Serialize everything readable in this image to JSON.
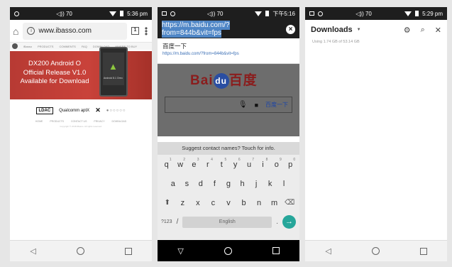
{
  "phone1": {
    "status": {
      "volume": "◁)) 70",
      "time": "5:36 pm"
    },
    "url": "www.ibasso.com",
    "tabs_count": "1",
    "site_nav": [
      "PRODUCTS",
      "COMMENTS",
      "FAQ",
      "DOWNLOAD",
      "WHERE TO BUY"
    ],
    "site_logo_text": "iBasso",
    "banner_lines": [
      "DX200 Android O",
      "Official Release V1.0",
      "Available for Download"
    ],
    "device_text": "Android 8.1 Oreo",
    "badges": {
      "ldac": "LDAC",
      "qualcomm": "Qualcomm aptX",
      "dots": "●○○○○○"
    },
    "footer_links": [
      "HOME",
      "PRODUCTS",
      "CONTACT US",
      "PRIVACY",
      "DOWNLOAD"
    ],
    "copyright": "Copyright © 2018 iBasso. All rights reserved."
  },
  "phone2": {
    "status": {
      "volume": "◁)) 70",
      "time": "下午5:16"
    },
    "url": "https://m.baidu.com/?from=844b&vit=fps",
    "suggestion_title": "百度一下",
    "suggestion_url": "https://m.baidu.com/?from=844b&vit=fps",
    "baidu_logo_left": "Bai",
    "baidu_logo_paw": "du",
    "baidu_logo_right": "百度",
    "search_button": "百度一下",
    "keyboard_suggest": "Suggest contact names? Touch for info.",
    "row1": [
      "q",
      "w",
      "e",
      "r",
      "t",
      "y",
      "u",
      "i",
      "o",
      "p"
    ],
    "row1_nums": [
      "1",
      "2",
      "3",
      "4",
      "5",
      "6",
      "7",
      "8",
      "9",
      "0"
    ],
    "row2": [
      "a",
      "s",
      "d",
      "f",
      "g",
      "h",
      "j",
      "k",
      "l"
    ],
    "row3": [
      "z",
      "x",
      "c",
      "v",
      "b",
      "n",
      "m"
    ],
    "sym_key": "?123",
    "slash_key": "/",
    "space_label": "English",
    "period_key": "."
  },
  "phone3": {
    "status": {
      "volume": "◁)) 70",
      "time": "5:29 pm"
    },
    "title": "Downloads",
    "usage": "Using 1.74 GB of 53.14 GB"
  },
  "icons": [
    "home-icon",
    "info-icon",
    "tabs-icon",
    "menu-icon",
    "clear-icon",
    "mic-icon",
    "camera-icon",
    "shift-icon",
    "backspace-icon",
    "go-icon",
    "settings-icon",
    "search-icon",
    "close-icon",
    "back-icon",
    "home-nav-icon",
    "recents-icon"
  ]
}
